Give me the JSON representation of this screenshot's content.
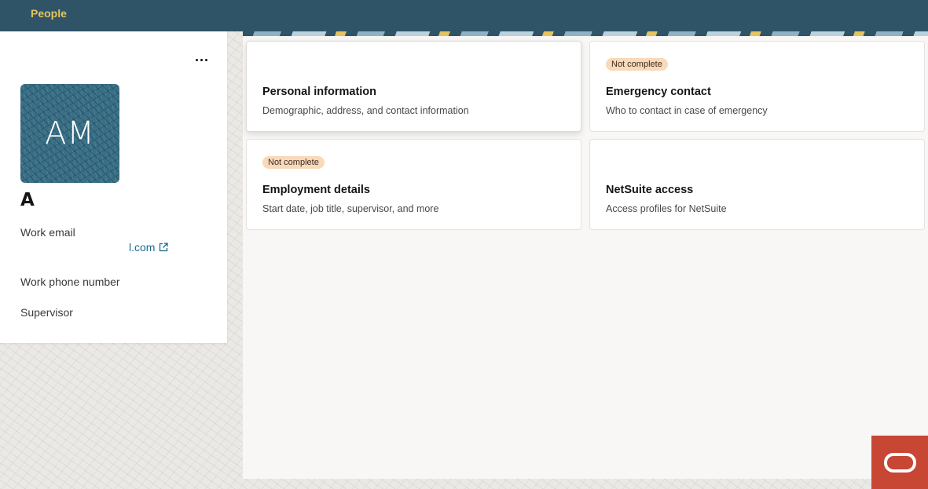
{
  "header": {
    "title": "People"
  },
  "profile": {
    "initials": "AM",
    "name": "A",
    "more_icon": "more-horizontal-icon",
    "fields": {
      "work_email_label": "Work email",
      "work_email_value": "l.com",
      "work_phone_label": "Work phone number",
      "supervisor_label": "Supervisor"
    },
    "external_link_icon": "external-link-icon"
  },
  "cards": [
    {
      "title": "Personal information",
      "description": "Demographic, address, and contact information",
      "badge": ""
    },
    {
      "title": "Emergency contact",
      "description": "Who to contact in case of emergency",
      "badge": "Not complete"
    },
    {
      "title": "Employment details",
      "description": "Start date, job title, supervisor, and more",
      "badge": "Not complete"
    },
    {
      "title": "NetSuite access",
      "description": "Access profiles for NetSuite",
      "badge": ""
    }
  ],
  "assistant": {
    "icon": "oracle-logo-icon"
  },
  "colors": {
    "header_bg": "#2f5468",
    "header_title": "#e6c35c",
    "badge_bg": "#f9d9b9",
    "link": "#1f6a8c",
    "oracle_red": "#c74634"
  }
}
